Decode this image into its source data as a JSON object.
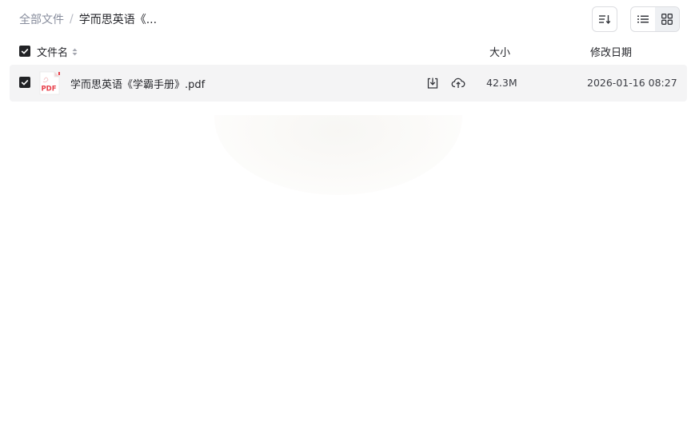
{
  "breadcrumb": {
    "root": "全部文件",
    "separator": "/",
    "current": "学而思英语《..."
  },
  "toolbar": {
    "sort_icon": "sort-icon",
    "list_view_icon": "list-view-icon",
    "grid_view_icon": "grid-view-icon",
    "active_view": "grid"
  },
  "table": {
    "headers": {
      "name": "文件名",
      "size": "大小",
      "date": "修改日期"
    },
    "rows": [
      {
        "checked": true,
        "icon": "pdf-file-icon",
        "icon_label": "PDF",
        "name": "学而思英语《学霸手册》.pdf",
        "size": "42.3M",
        "date": "2026-01-16 08:27"
      }
    ]
  },
  "colors": {
    "accent": "#222326",
    "row_bg": "#f4f4f5",
    "pdf_red": "#e8414b"
  }
}
